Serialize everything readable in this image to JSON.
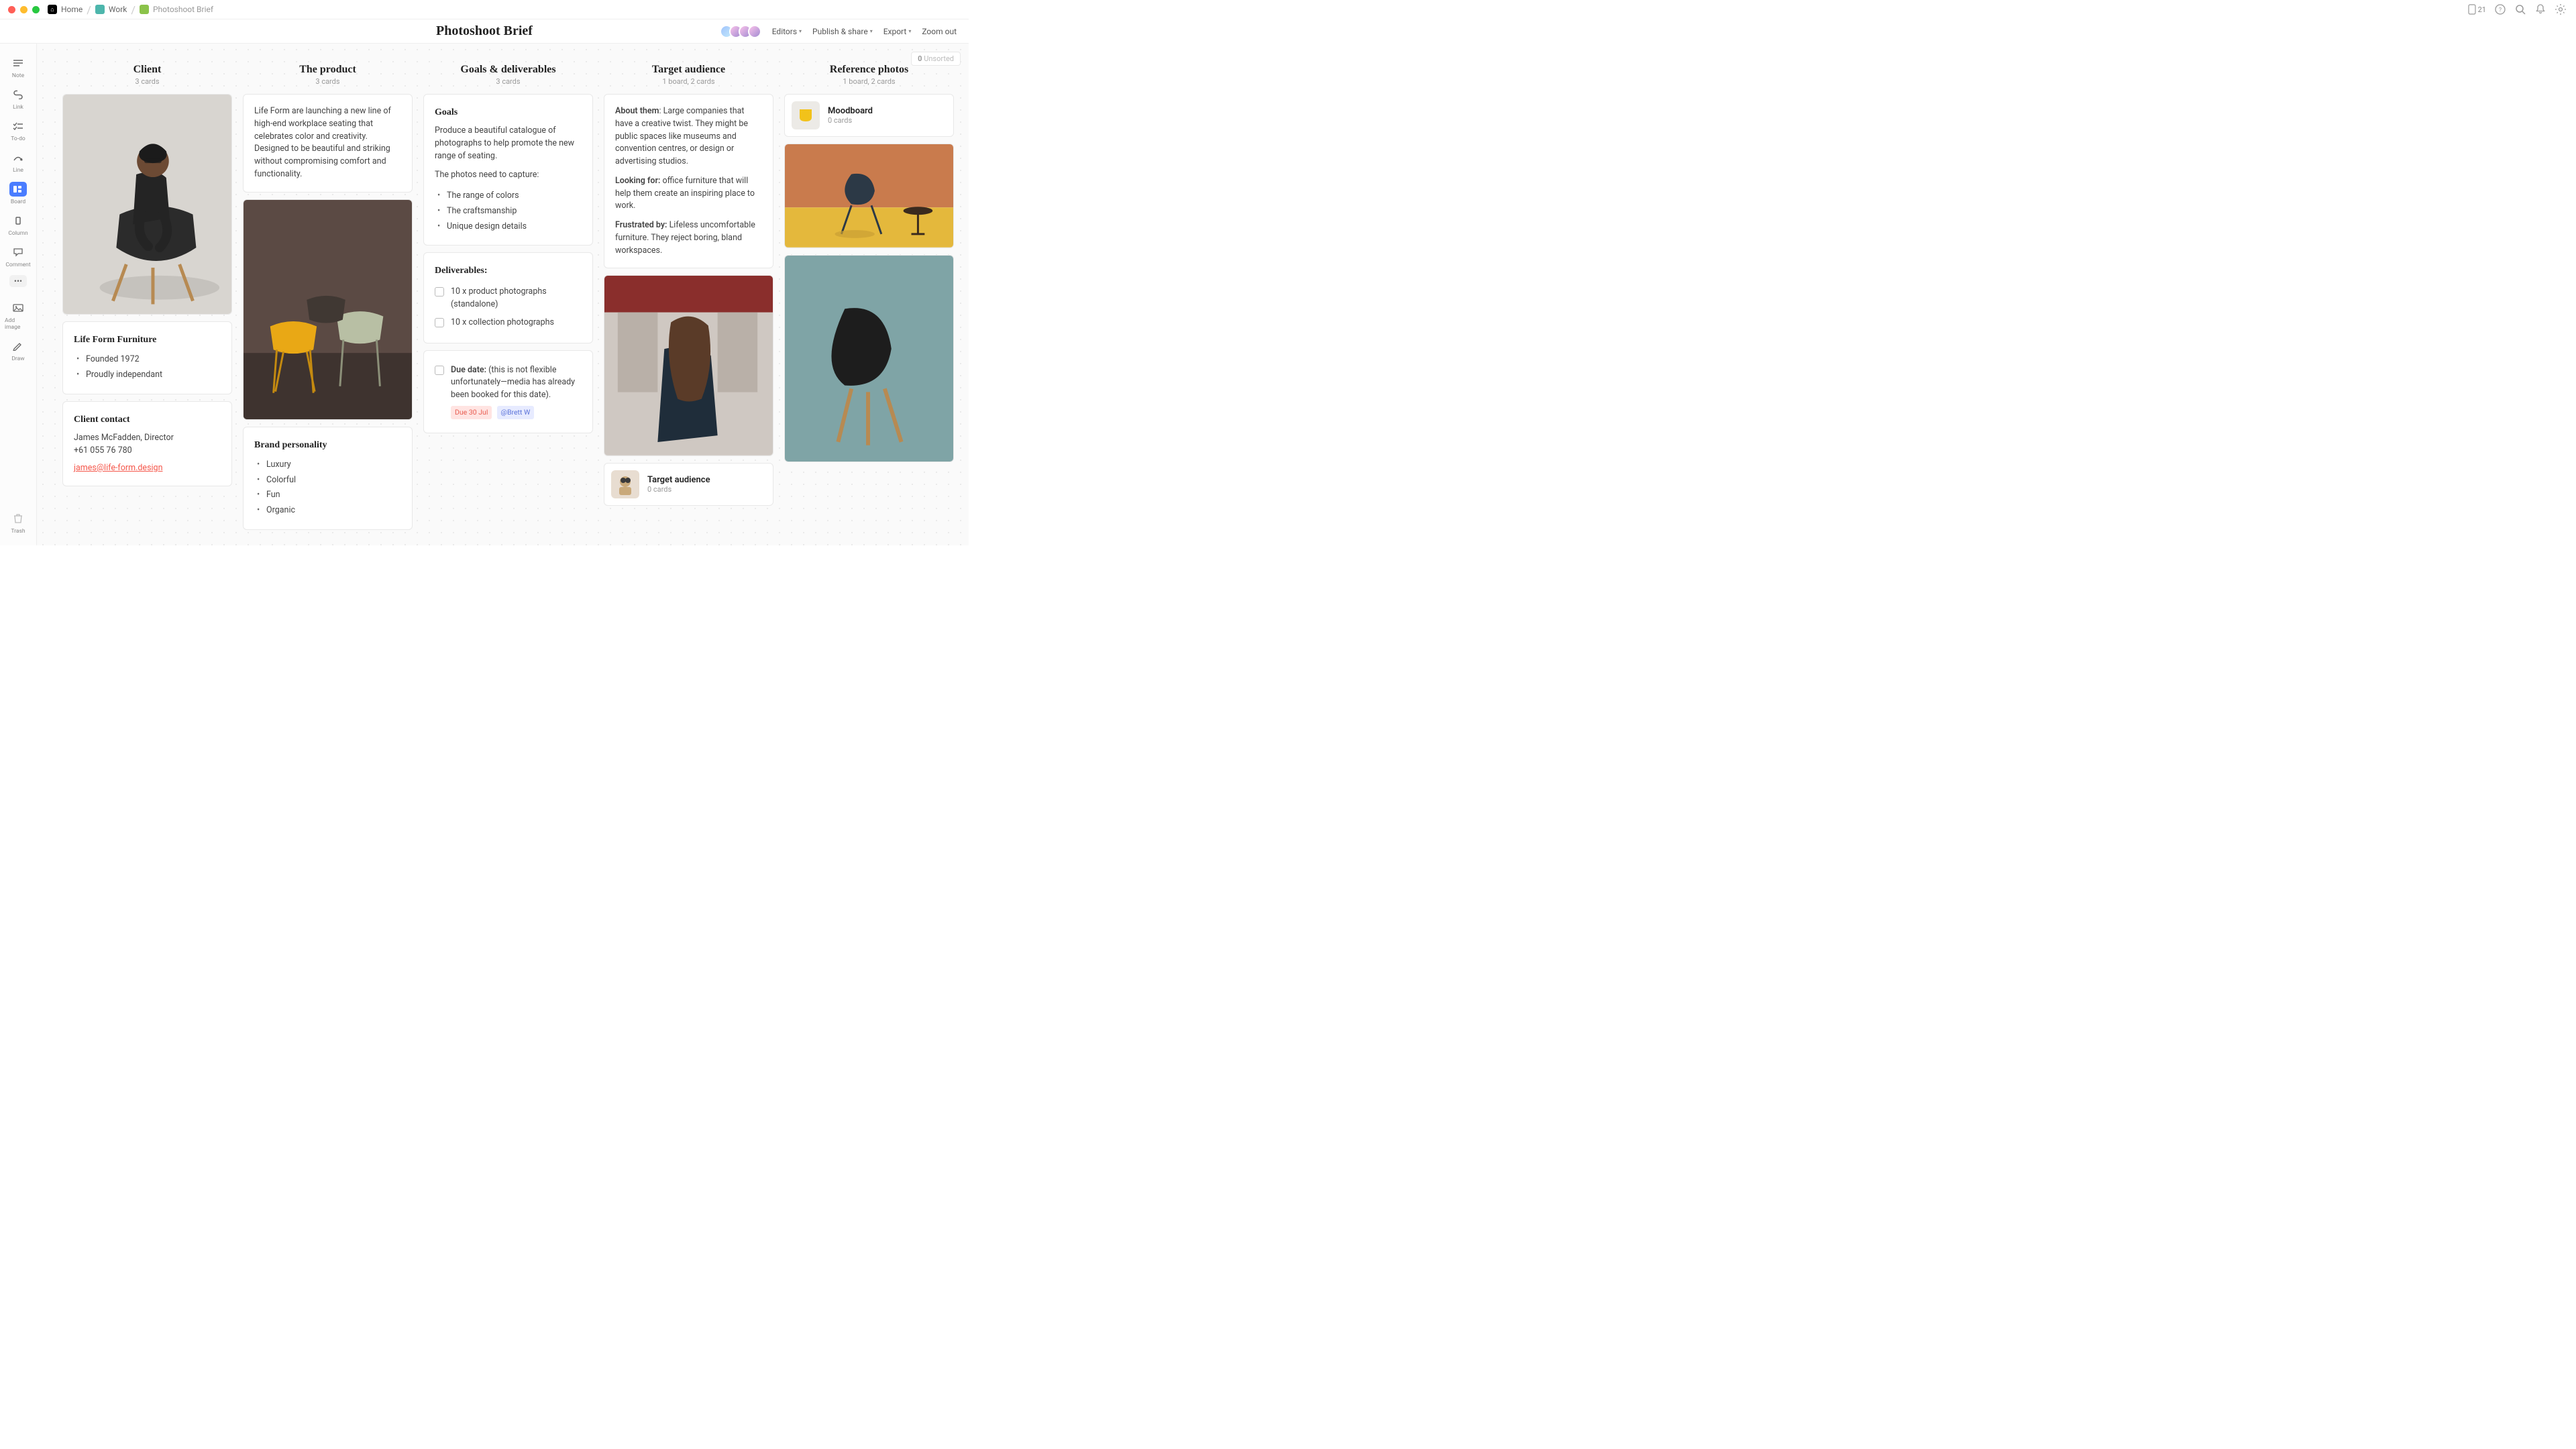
{
  "chrome": {
    "breadcrumb": {
      "home": "Home",
      "work": "Work",
      "current": "Photoshoot Brief"
    }
  },
  "topbar": {
    "phone_count": "21",
    "page_title": "Photoshoot Brief",
    "editors": "Editors",
    "publish": "Publish & share",
    "export": "Export",
    "zoom": "Zoom out"
  },
  "sidebar": {
    "note": "Note",
    "link": "Link",
    "todo": "To-do",
    "line": "Line",
    "board": "Board",
    "column": "Column",
    "comment": "Comment",
    "add_image": "Add image",
    "draw": "Draw",
    "trash": "Trash"
  },
  "unsorted": {
    "count": "0",
    "label": "Unsorted"
  },
  "columns": {
    "client": {
      "title": "Client",
      "sub": "3 cards"
    },
    "product": {
      "title": "The product",
      "sub": "3 cards"
    },
    "goals": {
      "title": "Goals & deliverables",
      "sub": "3 cards"
    },
    "audience": {
      "title": "Target audience",
      "sub": "1 board, 2 cards"
    },
    "reference": {
      "title": "Reference photos",
      "sub": "1 board, 2 cards"
    }
  },
  "client": {
    "company_heading": "Life Form Furniture",
    "facts": [
      "Founded 1972",
      "Proudly independant"
    ],
    "contact_heading": "Client contact",
    "contact_name": "James McFadden, Director",
    "contact_phone": "+61 055 76 780",
    "contact_email": "james@life-form.design"
  },
  "product": {
    "intro": "Life Form are launching a new line of high-end workplace seating that celebrates color and creativity. Designed to be beautiful and striking without compromising comfort and functionality.",
    "brand_heading": "Brand personality",
    "brand_items": [
      "Luxury",
      "Colorful",
      "Fun",
      "Organic"
    ]
  },
  "goals": {
    "goals_heading": "Goals",
    "goals_p1": "Produce a beautiful catalogue of photographs to help promote the new range of seating.",
    "goals_p2": "The photos need to capture:",
    "goals_list": [
      "The range of colors",
      "The craftsmanship",
      "Unique design details"
    ],
    "deliv_heading": "Deliverables:",
    "deliv_1": "10 x product photographs (standalone)",
    "deliv_2": "10 x collection photographs",
    "due_label": "Due date:",
    "due_body": " (this is not flexible unfortunately—media has already been booked for this date).",
    "due_tag": "Due 30 Jul",
    "mention_tag": "@Brett W"
  },
  "audience": {
    "about_label": "About them",
    "about_body": ": Large companies that have a creative twist. They might be public spaces like museums and convention centres, or design or advertising studios.",
    "looking_label": "Looking for:",
    "looking_body": " office furniture that will help them create an inspiring place to work.",
    "frustrated_label": "Frustrated by:",
    "frustrated_body": " Lifeless uncomfortable furniture. They reject boring, bland workspaces.",
    "nested_title": "Target audience",
    "nested_sub": "0 cards"
  },
  "reference": {
    "mood_title": "Moodboard",
    "mood_sub": "0 cards"
  }
}
